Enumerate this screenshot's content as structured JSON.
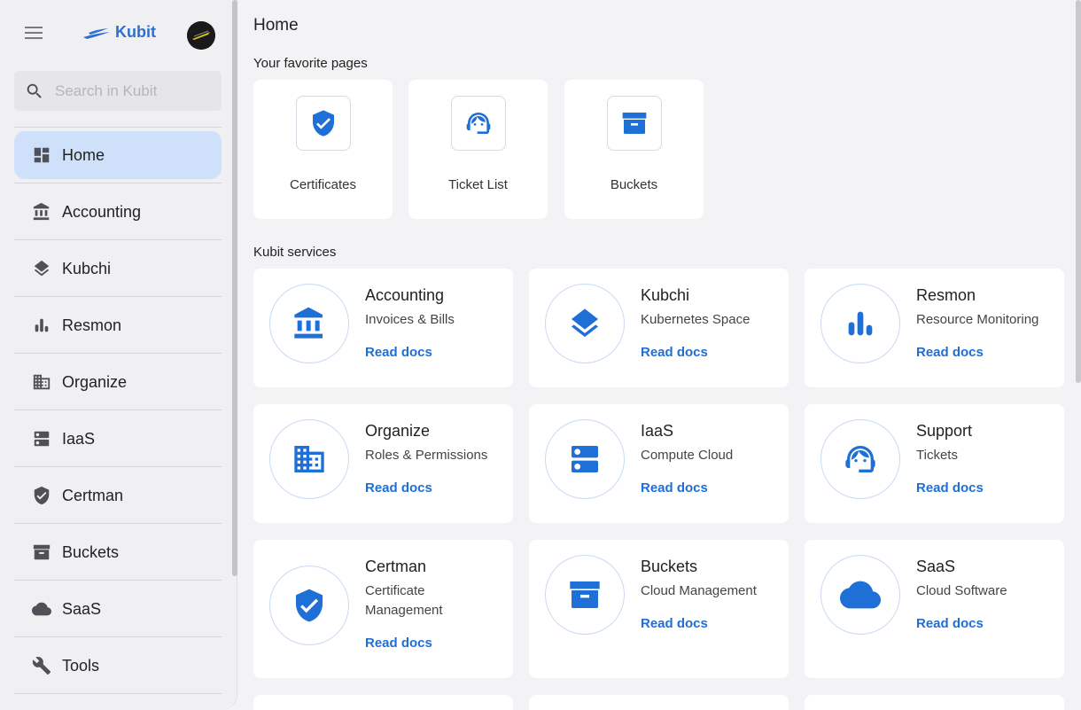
{
  "app": {
    "name": "Kubit"
  },
  "search": {
    "placeholder": "Search in Kubit"
  },
  "sidebar": {
    "items": [
      {
        "label": "Home",
        "icon": "dashboard-icon"
      },
      {
        "label": "Accounting",
        "icon": "bank-icon"
      },
      {
        "label": "Kubchi",
        "icon": "layers-icon"
      },
      {
        "label": "Resmon",
        "icon": "bar-chart-icon"
      },
      {
        "label": "Organize",
        "icon": "building-icon"
      },
      {
        "label": "IaaS",
        "icon": "server-icon"
      },
      {
        "label": "Certman",
        "icon": "shield-check-icon"
      },
      {
        "label": "Buckets",
        "icon": "archive-icon"
      },
      {
        "label": "SaaS",
        "icon": "cloud-icon"
      },
      {
        "label": "Tools",
        "icon": "wrench-icon"
      }
    ],
    "active": "Home"
  },
  "main": {
    "title": "Home",
    "favorites_title": "Your favorite pages",
    "favorites": [
      {
        "label": "Certificates",
        "icon": "shield-check-icon"
      },
      {
        "label": "Ticket List",
        "icon": "support-agent-icon"
      },
      {
        "label": "Buckets",
        "icon": "archive-icon"
      }
    ],
    "services_title": "Kubit services",
    "services": [
      {
        "title": "Accounting",
        "subtitle": "Invoices & Bills",
        "link": "Read docs",
        "icon": "bank-icon"
      },
      {
        "title": "Kubchi",
        "subtitle": "Kubernetes Space",
        "link": "Read docs",
        "icon": "layers-icon"
      },
      {
        "title": "Resmon",
        "subtitle": "Resource Monitoring",
        "link": "Read docs",
        "icon": "bar-chart-icon"
      },
      {
        "title": "Organize",
        "subtitle": "Roles & Permissions",
        "link": "Read docs",
        "icon": "building-icon"
      },
      {
        "title": "IaaS",
        "subtitle": "Compute Cloud",
        "link": "Read docs",
        "icon": "server-icon"
      },
      {
        "title": "Support",
        "subtitle": "Tickets",
        "link": "Read docs",
        "icon": "support-agent-icon"
      },
      {
        "title": "Certman",
        "subtitle": "Certificate Management",
        "link": "Read docs",
        "icon": "shield-check-icon"
      },
      {
        "title": "Buckets",
        "subtitle": "Cloud Management",
        "link": "Read docs",
        "icon": "archive-icon"
      },
      {
        "title": "SaaS",
        "subtitle": "Cloud Software",
        "link": "Read docs",
        "icon": "cloud-icon"
      }
    ]
  },
  "colors": {
    "accent": "#1e6fd6",
    "active_bg": "#cfe0fb",
    "page_bg": "#f3f3f5"
  }
}
